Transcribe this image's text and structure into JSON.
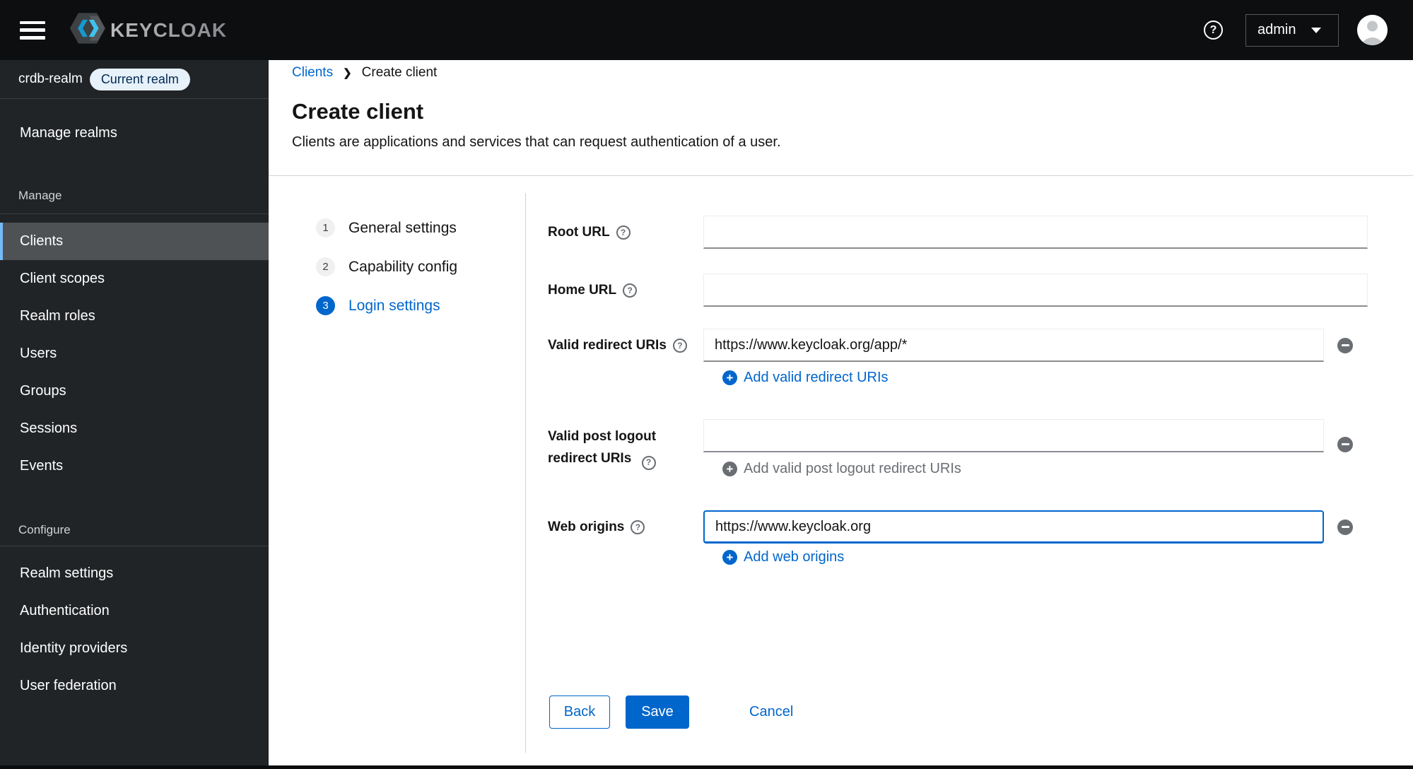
{
  "colors": {
    "accent": "#0066cc",
    "masthead_bg": "#0d0e10",
    "sidebar_bg": "#212427",
    "selected_item_bg": "#4f5255",
    "selected_item_border": "#73bcf7",
    "badge_bg": "#e7f1fa",
    "badge_text": "#002952",
    "muted_gray": "#6a6e73"
  },
  "masthead": {
    "brand": "KEYCLOAK",
    "user": "admin"
  },
  "sidebar": {
    "realm_name": "crdb-realm",
    "realm_badge": "Current realm",
    "manage_realms": "Manage realms",
    "manage_title": "Manage",
    "manage_items": [
      "Clients",
      "Client scopes",
      "Realm roles",
      "Users",
      "Groups",
      "Sessions",
      "Events"
    ],
    "configure_title": "Configure",
    "configure_items": [
      "Realm settings",
      "Authentication",
      "Identity providers",
      "User federation"
    ]
  },
  "breadcrumb": {
    "parent": "Clients",
    "current": "Create client"
  },
  "page": {
    "title": "Create client",
    "subtitle": "Clients are applications and services that can request authentication of a user."
  },
  "wizard": {
    "step1": {
      "number": "1",
      "label": "General settings"
    },
    "step2": {
      "number": "2",
      "label": "Capability config"
    },
    "step3": {
      "number": "3",
      "label": "Login settings"
    }
  },
  "form": {
    "root_url": {
      "label": "Root URL",
      "value": ""
    },
    "home_url": {
      "label": "Home URL",
      "value": ""
    },
    "redirect_uris": {
      "label": "Valid redirect URIs",
      "value": "https://www.keycloak.org/app/*",
      "add_label": "Add valid redirect URIs"
    },
    "post_logout": {
      "label": "Valid post logout redirect URIs",
      "value": "",
      "add_label": "Add valid post logout redirect URIs"
    },
    "web_origins": {
      "label": "Web origins",
      "value": "https://www.keycloak.org",
      "add_label": "Add web origins"
    }
  },
  "actions": {
    "back": "Back",
    "save": "Save",
    "cancel": "Cancel"
  }
}
